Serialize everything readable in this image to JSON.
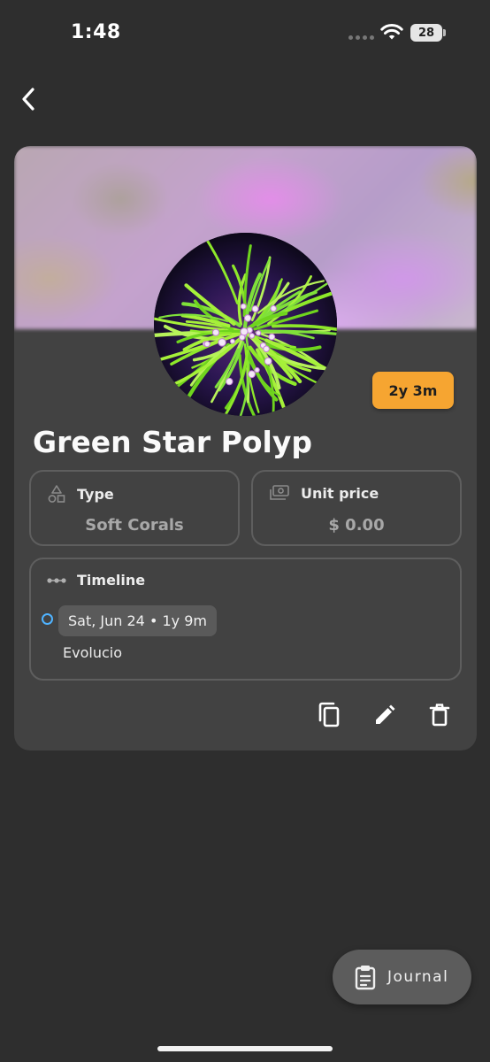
{
  "status_bar": {
    "time": "1:48",
    "battery": "28"
  },
  "item": {
    "name": "Green Star Polyp",
    "age_badge": "2y 3m",
    "type": {
      "label": "Type",
      "value": "Soft Corals"
    },
    "unit_price": {
      "label": "Unit price",
      "value": "$ 0.00"
    },
    "timeline": {
      "label": "Timeline",
      "entries": [
        {
          "date": "Sat, Jun 24 • 1y 9m",
          "text": "Evolucio"
        }
      ]
    }
  },
  "actions": {
    "copy": "copy-icon",
    "edit": "pencil-icon",
    "delete": "trash-icon"
  },
  "fab": {
    "label": "Journal",
    "icon": "clipboard-icon"
  },
  "colors": {
    "background": "#2e2e2e",
    "card": "#424242",
    "accent": "#f6a531",
    "timeline_dot": "#4fb3ff"
  }
}
